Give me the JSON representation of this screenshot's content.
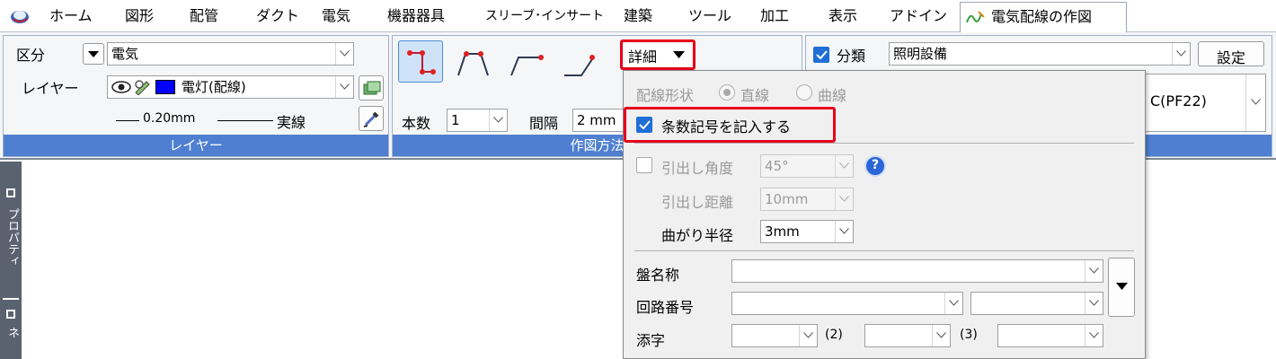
{
  "menu": {
    "items": [
      "ホーム",
      "図形",
      "配管",
      "ダクト",
      "電気",
      "機器器具",
      "スリーブ･インサート",
      "建築",
      "ツール",
      "加工",
      "表示",
      "アドイン"
    ],
    "active_tab": "電気配線の作図"
  },
  "layer_group": {
    "title": "レイヤー",
    "category_label": "区分",
    "category_value": "電気",
    "layer_label": "レイヤー",
    "layer_value": "電灯(配線)",
    "layer_color": "#0000ff",
    "line_width": "0.20mm",
    "line_type": "実線"
  },
  "draw_group": {
    "title": "作図方法",
    "detail_label": "詳細",
    "count_label": "本数",
    "count_value": "1",
    "spacing_label": "間隔",
    "spacing_value": "2 mm"
  },
  "classify_group": {
    "checkbox_label": "分類",
    "checked": true,
    "value": "照明設備",
    "settings_label": "設定",
    "pipe_value": "C(PF22)"
  },
  "side_panel": {
    "label_properties": "プロパティ",
    "label_2": "ネ"
  },
  "detail_panel": {
    "wiring_shape_label": "配線形状",
    "option_straight": "直線",
    "option_curve": "曲線",
    "draw_count_symbol_label": "条数記号を記入する",
    "draw_count_symbol_checked": true,
    "lead_angle_label": "引出し角度",
    "lead_angle_value": "45°",
    "lead_distance_label": "引出し距離",
    "lead_distance_value": "10mm",
    "bend_radius_label": "曲がり半径",
    "bend_radius_value": "3mm",
    "panel_name_label": "盤名称",
    "circuit_number_label": "回路番号",
    "suffix_label": "添字",
    "suffix_2": "(2)",
    "suffix_3": "(3)"
  },
  "colors": {
    "accent_blue": "#4f7fd0",
    "highlight_red": "#e5001c",
    "checkbox_blue": "#1f6fd6"
  }
}
